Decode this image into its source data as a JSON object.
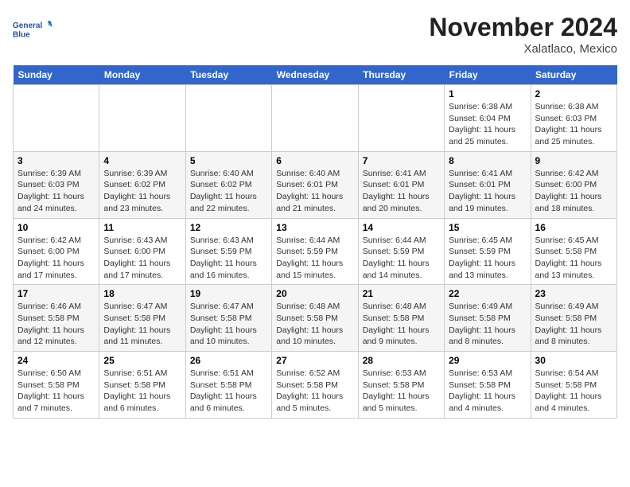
{
  "header": {
    "logo_text_general": "General",
    "logo_text_blue": "Blue",
    "month_title": "November 2024",
    "location": "Xalatlaco, Mexico"
  },
  "days_of_week": [
    "Sunday",
    "Monday",
    "Tuesday",
    "Wednesday",
    "Thursday",
    "Friday",
    "Saturday"
  ],
  "weeks": [
    [
      {
        "day": "",
        "info": ""
      },
      {
        "day": "",
        "info": ""
      },
      {
        "day": "",
        "info": ""
      },
      {
        "day": "",
        "info": ""
      },
      {
        "day": "",
        "info": ""
      },
      {
        "day": "1",
        "info": "Sunrise: 6:38 AM\nSunset: 6:04 PM\nDaylight: 11 hours and 25 minutes."
      },
      {
        "day": "2",
        "info": "Sunrise: 6:38 AM\nSunset: 6:03 PM\nDaylight: 11 hours and 25 minutes."
      }
    ],
    [
      {
        "day": "3",
        "info": "Sunrise: 6:39 AM\nSunset: 6:03 PM\nDaylight: 11 hours and 24 minutes."
      },
      {
        "day": "4",
        "info": "Sunrise: 6:39 AM\nSunset: 6:02 PM\nDaylight: 11 hours and 23 minutes."
      },
      {
        "day": "5",
        "info": "Sunrise: 6:40 AM\nSunset: 6:02 PM\nDaylight: 11 hours and 22 minutes."
      },
      {
        "day": "6",
        "info": "Sunrise: 6:40 AM\nSunset: 6:01 PM\nDaylight: 11 hours and 21 minutes."
      },
      {
        "day": "7",
        "info": "Sunrise: 6:41 AM\nSunset: 6:01 PM\nDaylight: 11 hours and 20 minutes."
      },
      {
        "day": "8",
        "info": "Sunrise: 6:41 AM\nSunset: 6:01 PM\nDaylight: 11 hours and 19 minutes."
      },
      {
        "day": "9",
        "info": "Sunrise: 6:42 AM\nSunset: 6:00 PM\nDaylight: 11 hours and 18 minutes."
      }
    ],
    [
      {
        "day": "10",
        "info": "Sunrise: 6:42 AM\nSunset: 6:00 PM\nDaylight: 11 hours and 17 minutes."
      },
      {
        "day": "11",
        "info": "Sunrise: 6:43 AM\nSunset: 6:00 PM\nDaylight: 11 hours and 17 minutes."
      },
      {
        "day": "12",
        "info": "Sunrise: 6:43 AM\nSunset: 5:59 PM\nDaylight: 11 hours and 16 minutes."
      },
      {
        "day": "13",
        "info": "Sunrise: 6:44 AM\nSunset: 5:59 PM\nDaylight: 11 hours and 15 minutes."
      },
      {
        "day": "14",
        "info": "Sunrise: 6:44 AM\nSunset: 5:59 PM\nDaylight: 11 hours and 14 minutes."
      },
      {
        "day": "15",
        "info": "Sunrise: 6:45 AM\nSunset: 5:59 PM\nDaylight: 11 hours and 13 minutes."
      },
      {
        "day": "16",
        "info": "Sunrise: 6:45 AM\nSunset: 5:58 PM\nDaylight: 11 hours and 13 minutes."
      }
    ],
    [
      {
        "day": "17",
        "info": "Sunrise: 6:46 AM\nSunset: 5:58 PM\nDaylight: 11 hours and 12 minutes."
      },
      {
        "day": "18",
        "info": "Sunrise: 6:47 AM\nSunset: 5:58 PM\nDaylight: 11 hours and 11 minutes."
      },
      {
        "day": "19",
        "info": "Sunrise: 6:47 AM\nSunset: 5:58 PM\nDaylight: 11 hours and 10 minutes."
      },
      {
        "day": "20",
        "info": "Sunrise: 6:48 AM\nSunset: 5:58 PM\nDaylight: 11 hours and 10 minutes."
      },
      {
        "day": "21",
        "info": "Sunrise: 6:48 AM\nSunset: 5:58 PM\nDaylight: 11 hours and 9 minutes."
      },
      {
        "day": "22",
        "info": "Sunrise: 6:49 AM\nSunset: 5:58 PM\nDaylight: 11 hours and 8 minutes."
      },
      {
        "day": "23",
        "info": "Sunrise: 6:49 AM\nSunset: 5:58 PM\nDaylight: 11 hours and 8 minutes."
      }
    ],
    [
      {
        "day": "24",
        "info": "Sunrise: 6:50 AM\nSunset: 5:58 PM\nDaylight: 11 hours and 7 minutes."
      },
      {
        "day": "25",
        "info": "Sunrise: 6:51 AM\nSunset: 5:58 PM\nDaylight: 11 hours and 6 minutes."
      },
      {
        "day": "26",
        "info": "Sunrise: 6:51 AM\nSunset: 5:58 PM\nDaylight: 11 hours and 6 minutes."
      },
      {
        "day": "27",
        "info": "Sunrise: 6:52 AM\nSunset: 5:58 PM\nDaylight: 11 hours and 5 minutes."
      },
      {
        "day": "28",
        "info": "Sunrise: 6:53 AM\nSunset: 5:58 PM\nDaylight: 11 hours and 5 minutes."
      },
      {
        "day": "29",
        "info": "Sunrise: 6:53 AM\nSunset: 5:58 PM\nDaylight: 11 hours and 4 minutes."
      },
      {
        "day": "30",
        "info": "Sunrise: 6:54 AM\nSunset: 5:58 PM\nDaylight: 11 hours and 4 minutes."
      }
    ]
  ]
}
